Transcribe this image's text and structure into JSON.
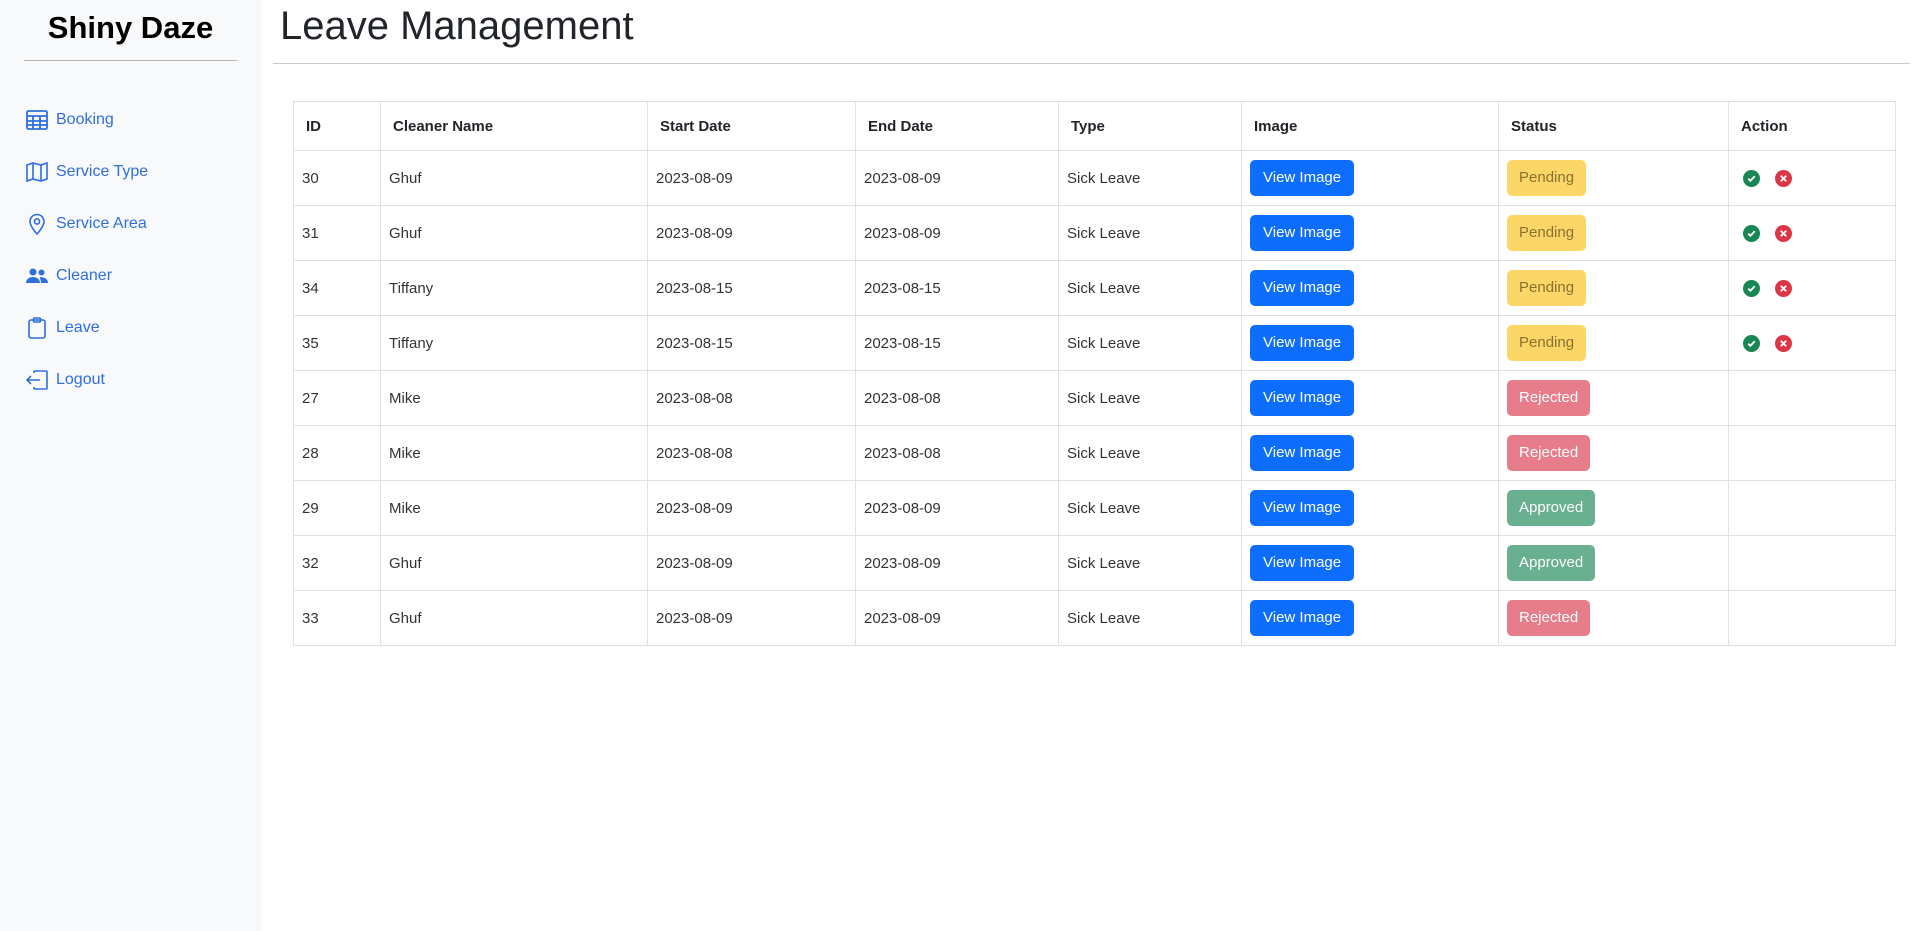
{
  "brand": "Shiny Daze",
  "sidebar": {
    "items": [
      {
        "label": "Booking",
        "icon": "table-icon"
      },
      {
        "label": "Service Type",
        "icon": "map-icon"
      },
      {
        "label": "Service Area",
        "icon": "location-pin-icon"
      },
      {
        "label": "Cleaner",
        "icon": "people-icon"
      },
      {
        "label": "Leave",
        "icon": "clipboard-icon"
      },
      {
        "label": "Logout",
        "icon": "logout-icon"
      }
    ]
  },
  "page_title": "Leave Management",
  "table": {
    "headers": [
      "ID",
      "Cleaner Name",
      "Start Date",
      "End Date",
      "Type",
      "Image",
      "Status",
      "Action"
    ],
    "view_label": "View Image",
    "rows": [
      {
        "id": "30",
        "name": "Ghuf",
        "start": "2023-08-09",
        "end": "2023-08-09",
        "type": "Sick Leave",
        "status": "Pending"
      },
      {
        "id": "31",
        "name": "Ghuf",
        "start": "2023-08-09",
        "end": "2023-08-09",
        "type": "Sick Leave",
        "status": "Pending"
      },
      {
        "id": "34",
        "name": "Tiffany",
        "start": "2023-08-15",
        "end": "2023-08-15",
        "type": "Sick Leave",
        "status": "Pending"
      },
      {
        "id": "35",
        "name": "Tiffany",
        "start": "2023-08-15",
        "end": "2023-08-15",
        "type": "Sick Leave",
        "status": "Pending"
      },
      {
        "id": "27",
        "name": "Mike",
        "start": "2023-08-08",
        "end": "2023-08-08",
        "type": "Sick Leave",
        "status": "Rejected"
      },
      {
        "id": "28",
        "name": "Mike",
        "start": "2023-08-08",
        "end": "2023-08-08",
        "type": "Sick Leave",
        "status": "Rejected"
      },
      {
        "id": "29",
        "name": "Mike",
        "start": "2023-08-09",
        "end": "2023-08-09",
        "type": "Sick Leave",
        "status": "Approved"
      },
      {
        "id": "32",
        "name": "Ghuf",
        "start": "2023-08-09",
        "end": "2023-08-09",
        "type": "Sick Leave",
        "status": "Approved"
      },
      {
        "id": "33",
        "name": "Ghuf",
        "start": "2023-08-09",
        "end": "2023-08-09",
        "type": "Sick Leave",
        "status": "Rejected"
      }
    ]
  },
  "colors": {
    "link": "#2f6fdb",
    "primary": "#0d6efd",
    "pending": "#fcd666",
    "rejected": "#e77c8a",
    "approved": "#69b090",
    "approve_icon": "#198754",
    "reject_icon": "#dc3545"
  }
}
